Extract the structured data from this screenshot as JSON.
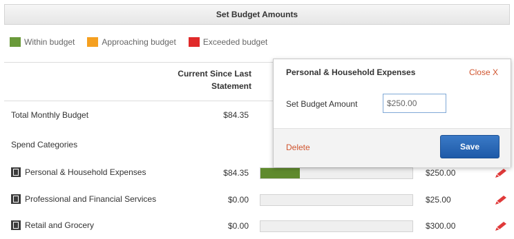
{
  "title": "Set Budget Amounts",
  "legend": [
    {
      "label": "Within budget",
      "color": "#6a9a3a"
    },
    {
      "label": "Approaching budget",
      "color": "#f5a020"
    },
    {
      "label": "Exceeded budget",
      "color": "#e02a2a"
    }
  ],
  "column_header": {
    "line1": "Current Since Last",
    "line2": "Statement"
  },
  "total_row": {
    "label": "Total Monthly Budget",
    "amount": "$84.35"
  },
  "section_label": "Spend Categories",
  "categories": [
    {
      "label": "Personal & Household Expenses",
      "amount": "$84.35",
      "budget": "$250.00",
      "progress": 0.26,
      "icon": "building-icon"
    },
    {
      "label": "Professional and Financial Services",
      "amount": "$0.00",
      "budget": "$25.00",
      "progress": 0,
      "icon": "briefcase-icon"
    },
    {
      "label": "Retail and Grocery",
      "amount": "$0.00",
      "budget": "$300.00",
      "progress": 0,
      "icon": "store-icon"
    }
  ],
  "popup": {
    "title": "Personal & Household Expenses",
    "close_label": "Close X",
    "field_label": "Set Budget Amount",
    "field_value": "$250.00",
    "delete_label": "Delete",
    "save_label": "Save"
  },
  "colors": {
    "accent": "#2a67b6",
    "link": "#d0542e",
    "edit_icon": "#e03a3a",
    "bar_fill": "#5f8a2d"
  }
}
